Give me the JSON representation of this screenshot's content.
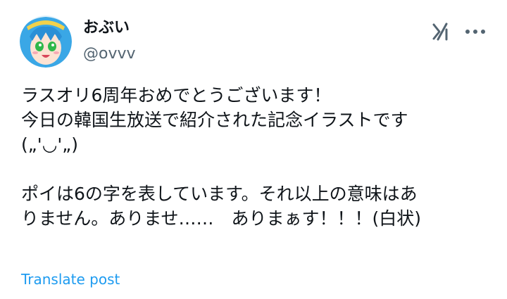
{
  "author": {
    "display_name": "おぶい",
    "handle": "@ovvv"
  },
  "header_icons": {
    "grok": "grok-icon",
    "more": "more-icon"
  },
  "tweet": {
    "lines": [
      "ラスオリ6周年おめでとうございます！",
      "今日の韓国生放送で紹介された記念イラストです",
      "(„'◡'„)",
      "",
      "ポイは6の字を表しています。それ以上の意味はあ",
      "りません。ありませ……　ありまぁす！！！(白状)"
    ]
  },
  "translate_label": "Translate post",
  "colors": {
    "text": "#0f1419",
    "secondary": "#536471",
    "link": "#1d9bf0"
  }
}
